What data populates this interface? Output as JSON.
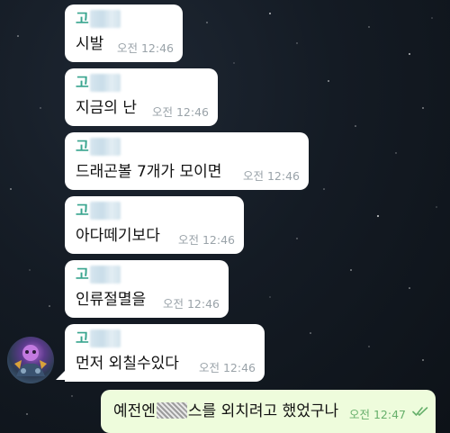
{
  "chat": {
    "messages": [
      {
        "sender_initial": "고",
        "text": "시발",
        "time": "오전 12:46"
      },
      {
        "sender_initial": "고",
        "text": "지금의 난",
        "time": "오전 12:46"
      },
      {
        "sender_initial": "고",
        "text": "드래곤볼 7개가 모이면",
        "time": "오전 12:46"
      },
      {
        "sender_initial": "고",
        "text": "아다떼기보다",
        "time": "오전 12:46"
      },
      {
        "sender_initial": "고",
        "text": "인류절멸을",
        "time": "오전 12:46"
      },
      {
        "sender_initial": "고",
        "text": "먼저 외칠수있다",
        "time": "오전 12:46"
      }
    ],
    "outgoing": {
      "text_before": "예전엔",
      "text_after": "스를 외치려고 했었구나",
      "time": "오전 12:47",
      "status_icon": "double-check-icon"
    }
  },
  "colors": {
    "sender_name": "#3aa58f",
    "incoming_bubble": "#ffffff",
    "outgoing_bubble": "#eefcdc",
    "outgoing_time": "#67b06b"
  }
}
